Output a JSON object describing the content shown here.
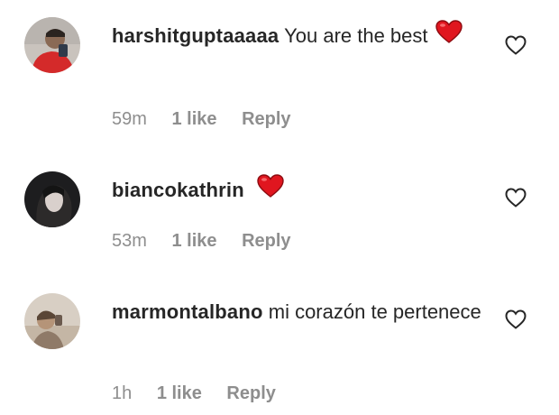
{
  "comments": [
    {
      "username": "harshitguptaaaaa",
      "text": "You are the best",
      "emoji": "red-heart",
      "time": "59m",
      "likes": "1 like",
      "reply": "Reply",
      "avatar": "avatar-photo-red-shirt"
    },
    {
      "username": "biancokathrin",
      "text": "",
      "emoji": "red-heart",
      "time": "53m",
      "likes": "1 like",
      "reply": "Reply",
      "avatar": "avatar-photo-dark-hair"
    },
    {
      "username": "marmontalbano",
      "text": "mi corazón te pertenece",
      "emoji": "",
      "time": "1h",
      "likes": "1 like",
      "reply": "Reply",
      "avatar": "avatar-photo-beige"
    }
  ],
  "colors": {
    "text": "#262626",
    "secondary": "#8e8e8e",
    "heart_emoji": "#e0161f",
    "like_icon_outline": "#262626"
  },
  "icons": {
    "like": "heart-outline-icon",
    "emoji": "red-heart-emoji"
  }
}
